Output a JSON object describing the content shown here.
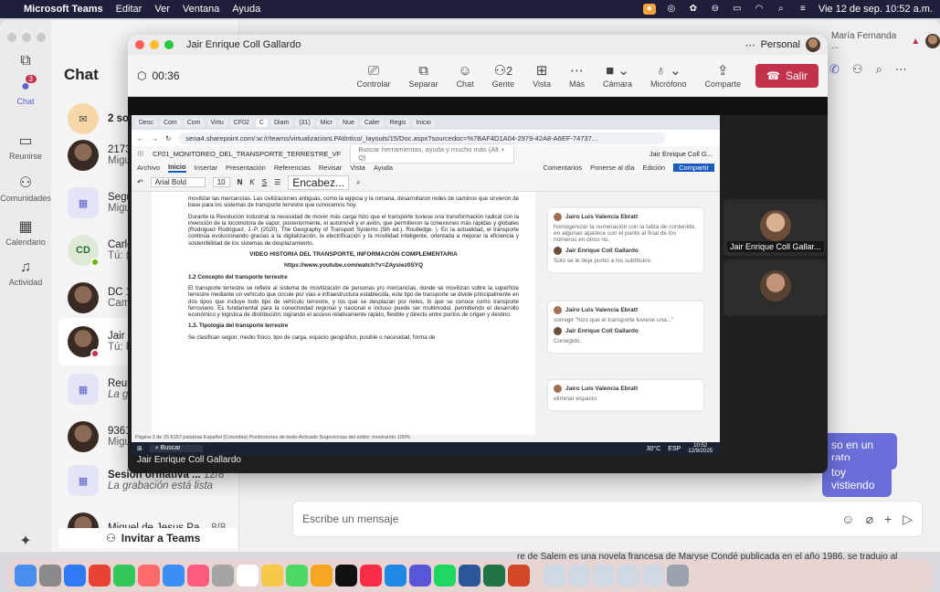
{
  "menubar": {
    "app": "Microsoft Teams",
    "items": [
      "Editar",
      "Ver",
      "Ventana",
      "Ayuda"
    ],
    "clock": "Vie 12 de sep. 10:52 a.m."
  },
  "rail": {
    "items": [
      {
        "label": "Chat",
        "badge": "3"
      },
      {
        "label": "Reunirse"
      },
      {
        "label": "Comunidades"
      },
      {
        "label": "Calendario"
      },
      {
        "label": "Actividad"
      }
    ]
  },
  "chatlist": {
    "title": "Chat",
    "rows": [
      {
        "name": "2 sol",
        "preview": "",
        "avatar": ""
      },
      {
        "name": "2173",
        "preview": "Migu",
        "avatar": ""
      },
      {
        "name": "Segu",
        "preview": "Migu",
        "avatar": ""
      },
      {
        "name": "Carlo",
        "preview": "Tú: (",
        "avatar": "CD"
      },
      {
        "name": "DC 1",
        "preview": "Cam",
        "avatar": ""
      },
      {
        "name": "Jair I",
        "preview": "Tú: F",
        "avatar": ""
      },
      {
        "name": "Reur",
        "preview": "La gr",
        "avatar": ""
      },
      {
        "name": "9361",
        "preview": "Migu",
        "avatar": ""
      },
      {
        "name": "Sesión ormativa ...",
        "date": "12/8",
        "preview": "La grabación está lista",
        "avatar": ""
      },
      {
        "name": "Miguel de Jesus Pa...",
        "date": "8/8",
        "preview": "",
        "avatar": ""
      }
    ],
    "invite": "Invitar a Teams"
  },
  "main": {
    "header_user": "María Fernanda ...",
    "compose_placeholder": "Escribe un mensaje",
    "bubble1": "so en un rato",
    "bubble2": "toy vistiendo",
    "bg_text": "re de Salem es una novela francesa de Maryse Condé publicada en el año 1986, se tradujo al"
  },
  "meeting": {
    "title": "Jair Enrique Coll Gallardo",
    "account": "Personal",
    "timer": "00:36",
    "tools": [
      {
        "label": "Controlar",
        "icon": "control-icon"
      },
      {
        "label": "Separar",
        "icon": "popout-icon"
      },
      {
        "label": "Chat",
        "icon": "chat-icon"
      },
      {
        "label": "Gente",
        "icon": "people-icon",
        "count": "2"
      },
      {
        "label": "Vista",
        "icon": "view-icon"
      },
      {
        "label": "Más",
        "icon": "more-icon"
      },
      {
        "label": "Cámara",
        "icon": "camera-off-icon"
      },
      {
        "label": "Micrófono",
        "icon": "mic-icon"
      },
      {
        "label": "Comparte",
        "icon": "share-icon"
      }
    ],
    "leave": "Salir",
    "presenter_label": "Jair Enrique Coll Gallardo",
    "tile_label": "Jair Enrique Coll Gallar..."
  },
  "shared": {
    "tabs": [
      "Desc",
      "Com",
      "Com",
      "Virtu",
      "CF02",
      "C",
      "Diam",
      "(31)",
      "Micr",
      "Nue",
      "Caler",
      "Regis",
      "Inicio"
    ],
    "url": "sena4.sharepoint.com/:w:/r/teams/virtualizacionLPAtlntico/_layouts/15/Doc.aspx?sourcedoc=%7BAF4D1A04-2979-42A8-A6EF-74737...",
    "doc_name": "CF01_MONITOREO_DEL_TRANSPORTE_TERRESTRE_VF",
    "search": "Buscar herramientas, ayuda y mucho más (Alt + Q)",
    "user": "Jair Enrique Coll G...",
    "menu": [
      "Archivo",
      "Inicio",
      "Insertar",
      "Presentación",
      "Referencias",
      "Revisar",
      "Vista",
      "Ayuda"
    ],
    "ribbon": {
      "font": "Arial Bold",
      "size": "10",
      "style": "Encabez..."
    },
    "ribbon_right": [
      "Comentarios",
      "Ponerse al día",
      "Edición",
      "Compartir"
    ],
    "para0": "movilizar las mercancías. Las civilizaciones antiguas, como la egipcia y la romana, desarrollaron redes de caminos que sirvieron de base para los sistemas de transporte terrestre que conocemos hoy.",
    "para1": "Durante la Revolución Industrial la necesidad de mover más carga hizo que el transporte tuviese una transformación radical con la invención de la locomotora de vapor, posteriormente, el automóvil y el avión, que permitieron la conexiones más rápidas y globales (Rodriguez Rodriguez, J.-P. (2020). The Geography of Transport Systems (5th ed.). Routledge. ). En la actualidad, el transporte continúa evolucionando gracias a la digitalización, la electrificación y la movilidad inteligente, orientada a mejorar la eficiencia y sostenibilidad de los sistemas de desplazamiento.",
    "video_title": "VIDEO HISTORIA DEL TRANSPORTE, INFORMACIÓN COMPLEMENTARIA",
    "video_url": "https://www.youtube.com/watch?v=ZAysiez0SYQ",
    "sec2_title": "1.2 Concepto del transporte terrestre",
    "sec2_text": "El transporte terrestre se refiere al sistema de movilización de personas y/o mercancías, donde se movilizan sobre la superficie terrestre mediante un vehículo que circule por vías e infraestructura establecida, este tipo de transporte se divide principalmente en dos tipos que incluye todo tipo de vehículo terrestre, y los que se desplazan por rieles, lo que se conoce como transporte ferroviario. Es fundamental para la conectividad regional y nacional e incluso puede ser multimodal, permitiendo el desarrollo económico y logística de distribución; logrando el acceso relativamente rápido, flexible y directo entre puntos de origen y destino.",
    "sec3_title": "1.3. Tipología del transporte terrestre",
    "sec3_text": "Se clasifican según: medio físico, tipo de carga, espacio geográfico, posible o necesidad, forma de",
    "comments": [
      {
        "author": "Jairo Luis Valencia Ebratt",
        "text": "homogenizar la numeración con la tabla de contenido, en algunas aparece con el punto al final de los números en otros no.",
        "reply_author": "Jair Enrique Coll Gallardo",
        "reply": "Solo se le deja punto a los subtítulos."
      },
      {
        "author": "Jairo Luis Valencia Ebratt",
        "text": "corregir \"hizo que el transporte tuviese una...\"",
        "reply_author": "Jair Enrique Coll Gallardo",
        "reply": "Corregido."
      },
      {
        "author": "Jairo Luis Valencia Ebratt",
        "text": "eliminar espacio",
        "reply_author": "",
        "reply": ""
      }
    ],
    "status": "Página 3 de 25   6157 palabras   Español (Colombia)   Predicciones de texto:Activado   Sugerencias del editor: mostrando",
    "zoom": "100%",
    "win_search": "Buscar",
    "win_weather": "30°C",
    "win_lang": "ESP",
    "win_time": "10:52",
    "win_date": "12/9/2025"
  }
}
